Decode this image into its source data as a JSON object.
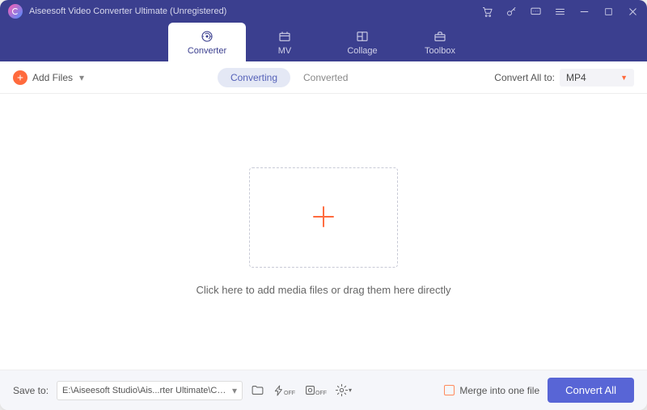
{
  "title": "Aiseesoft Video Converter Ultimate (Unregistered)",
  "tabs": {
    "converter": "Converter",
    "mv": "MV",
    "collage": "Collage",
    "toolbox": "Toolbox"
  },
  "toolbar": {
    "add_files": "Add Files",
    "converting": "Converting",
    "converted": "Converted",
    "convert_all_to": "Convert All to:",
    "format": "MP4"
  },
  "main": {
    "hint": "Click here to add media files or drag them here directly"
  },
  "footer": {
    "save_to": "Save to:",
    "path": "E:\\Aiseesoft Studio\\Ais...rter Ultimate\\Converted",
    "merge": "Merge into one file",
    "convert_all": "Convert All"
  }
}
